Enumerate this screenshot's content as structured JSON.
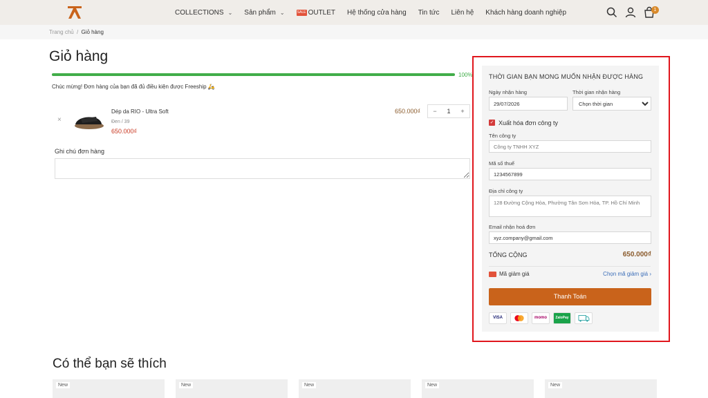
{
  "header": {
    "nav": [
      {
        "label": "COLLECTIONS",
        "has_dropdown": true
      },
      {
        "label": "Sản phẩm",
        "has_dropdown": true
      },
      {
        "label": "OUTLET",
        "badge": "SALE"
      },
      {
        "label": "Hệ thống cửa hàng"
      },
      {
        "label": "Tin tức"
      },
      {
        "label": "Liên hệ"
      },
      {
        "label": "Khách hàng doanh nghiệp"
      }
    ],
    "cart_count": "1",
    "icons": [
      "search-icon",
      "user-icon",
      "cart-icon"
    ]
  },
  "breadcrumb": {
    "home": "Trang chủ",
    "separator": "/",
    "current": "Giỏ hàng"
  },
  "cart": {
    "title": "Giỏ hàng",
    "progress_percent": 100,
    "progress_label": "100%",
    "freeship_message": "Chúc mừng! Đơn hàng của bạn đã đủ điều kiện được Freeship 🛵",
    "item": {
      "name": "Dép da RIO - Ultra Soft",
      "variant": "Đen / 39",
      "price": "650.000₫",
      "line_total": "650.000₫",
      "quantity": "1",
      "remove": "×",
      "minus": "−",
      "plus": "+"
    },
    "note_label": "Ghi chú đơn hàng",
    "note_value": ""
  },
  "checkout": {
    "title": "THỜI GIAN BẠN MONG MUỐN NHẬN ĐƯỢC HÀNG",
    "date_label": "Ngày nhận hàng",
    "date_value": "29/07/2026",
    "time_label": "Thời gian nhận hàng",
    "time_selected": "Chọn thời gian",
    "invoice_checked": true,
    "invoice_label": "Xuất hóa đơn công ty",
    "company_label": "Tên công ty",
    "company_value": "Công ty TNHH XYZ",
    "tax_label": "Mã số thuế",
    "tax_value": "1234567899",
    "address_label": "Địa chỉ công ty",
    "address_value": "128 Đường Cộng Hòa, Phường Tân Sơn Hòa, TP. Hồ Chí Minh",
    "email_label": "Email nhận hoá đơn",
    "email_value": "xyz.company@gmail.com",
    "total_label": "TỔNG CỘNG",
    "total_value": "650.000₫",
    "coupon_label": "Mã giảm giá",
    "coupon_link": "Chọn mã giảm giá",
    "coupon_chevron": "›",
    "pay_button": "Thanh Toán",
    "payment_methods": [
      "VISA",
      "mastercard",
      "momo",
      "ZaloPay",
      "cod"
    ]
  },
  "suggestions": {
    "title": "Có thể bạn sẽ thích",
    "badge": "New"
  },
  "colors": {
    "accent": "#c9631b",
    "highlight_border": "#e0151c",
    "progress": "#41ad49",
    "price": "#c8361f"
  }
}
